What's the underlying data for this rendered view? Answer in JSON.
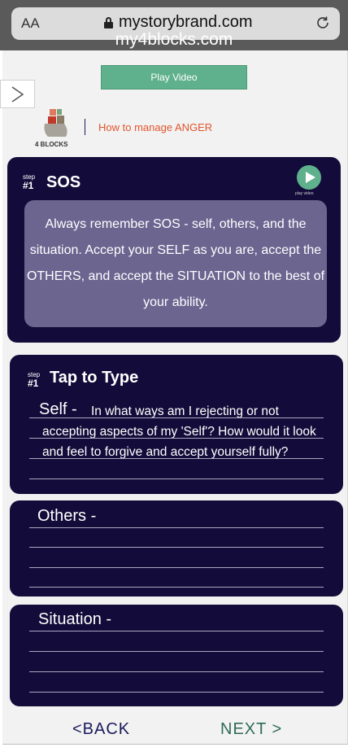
{
  "browser": {
    "text_size_label": "AA",
    "url": "mystorybrand.com",
    "site_title": "my4blocks.com"
  },
  "header": {
    "play_video_label": "Play Video",
    "logo_text": "4 BLOCKS",
    "subtitle_prefix": "How to manage ",
    "subtitle_emphasis": "ANGER"
  },
  "step1": {
    "step_word": "step",
    "step_number": "#1",
    "title": "SOS",
    "play_label": "play video",
    "body": "Always remember SOS - self, others, and the situation. Accept your SELF as you are, accept the OTHERS, and accept the SITUATION to the best of your ability."
  },
  "step2": {
    "step_word": "step",
    "step_number": "#1",
    "title": "Tap to Type",
    "self_label": "Self -",
    "self_question": "In what ways am I rejecting or not accepting aspects of my 'Self'? How would it look and feel to forgive and accept yourself fully?",
    "others_label": "Others -",
    "situation_label": "Situation -"
  },
  "footer": {
    "back_label": "<BACK",
    "next_label": "NEXT >"
  },
  "colors": {
    "card_bg": "#130c3a",
    "accent_green": "#5fb08c",
    "anger_orange": "#e2552e"
  }
}
